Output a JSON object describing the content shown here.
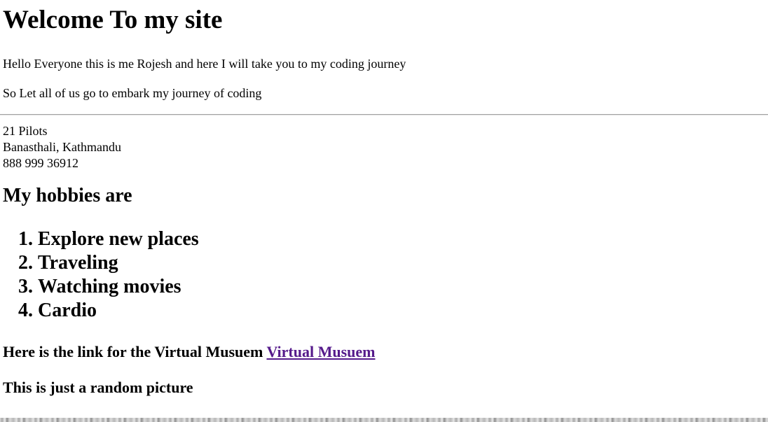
{
  "heading": "Welcome To my site",
  "intro": {
    "line1": "Hello Everyone this is me Rojesh and here I will take you to my coding journey",
    "line2": "So Let all of us go to embark my journey of coding"
  },
  "address": {
    "name": "21 Pilots",
    "location": "Banasthali, Kathmandu",
    "phone": "888 999 36912"
  },
  "hobbies": {
    "title": "My hobbies are",
    "items": [
      "Explore new places",
      "Traveling",
      "Watching movies",
      "Cardio"
    ]
  },
  "link_section": {
    "text": "Here is the link for the Virtual Musuem",
    "link_label": "Virtual Musuem",
    "link_color": "#551a8b"
  },
  "picture_section": {
    "caption": "This is just a random picture"
  }
}
